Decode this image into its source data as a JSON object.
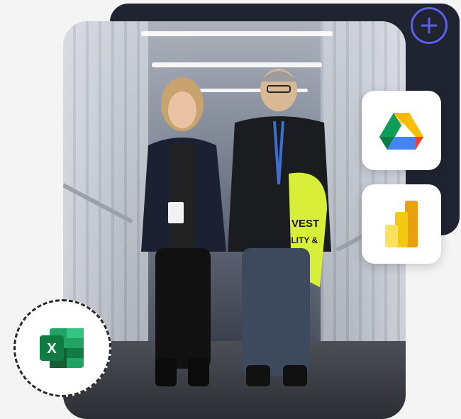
{
  "photo": {
    "vest_text_line1": "VEST",
    "vest_text_line2": "ILITY &"
  },
  "integrations": [
    {
      "name": "google-drive-icon"
    },
    {
      "name": "power-bi-icon"
    },
    {
      "name": "excel-icon",
      "letter": "X"
    }
  ],
  "add_button": {
    "icon": "plus-circle-icon"
  },
  "colors": {
    "panel": "#1f2430",
    "accent": "#5b5ef0",
    "excel_dark": "#107c41",
    "excel_light": "#33c481",
    "powerbi_dark": "#e8a10c",
    "powerbi_light": "#f2c811"
  }
}
